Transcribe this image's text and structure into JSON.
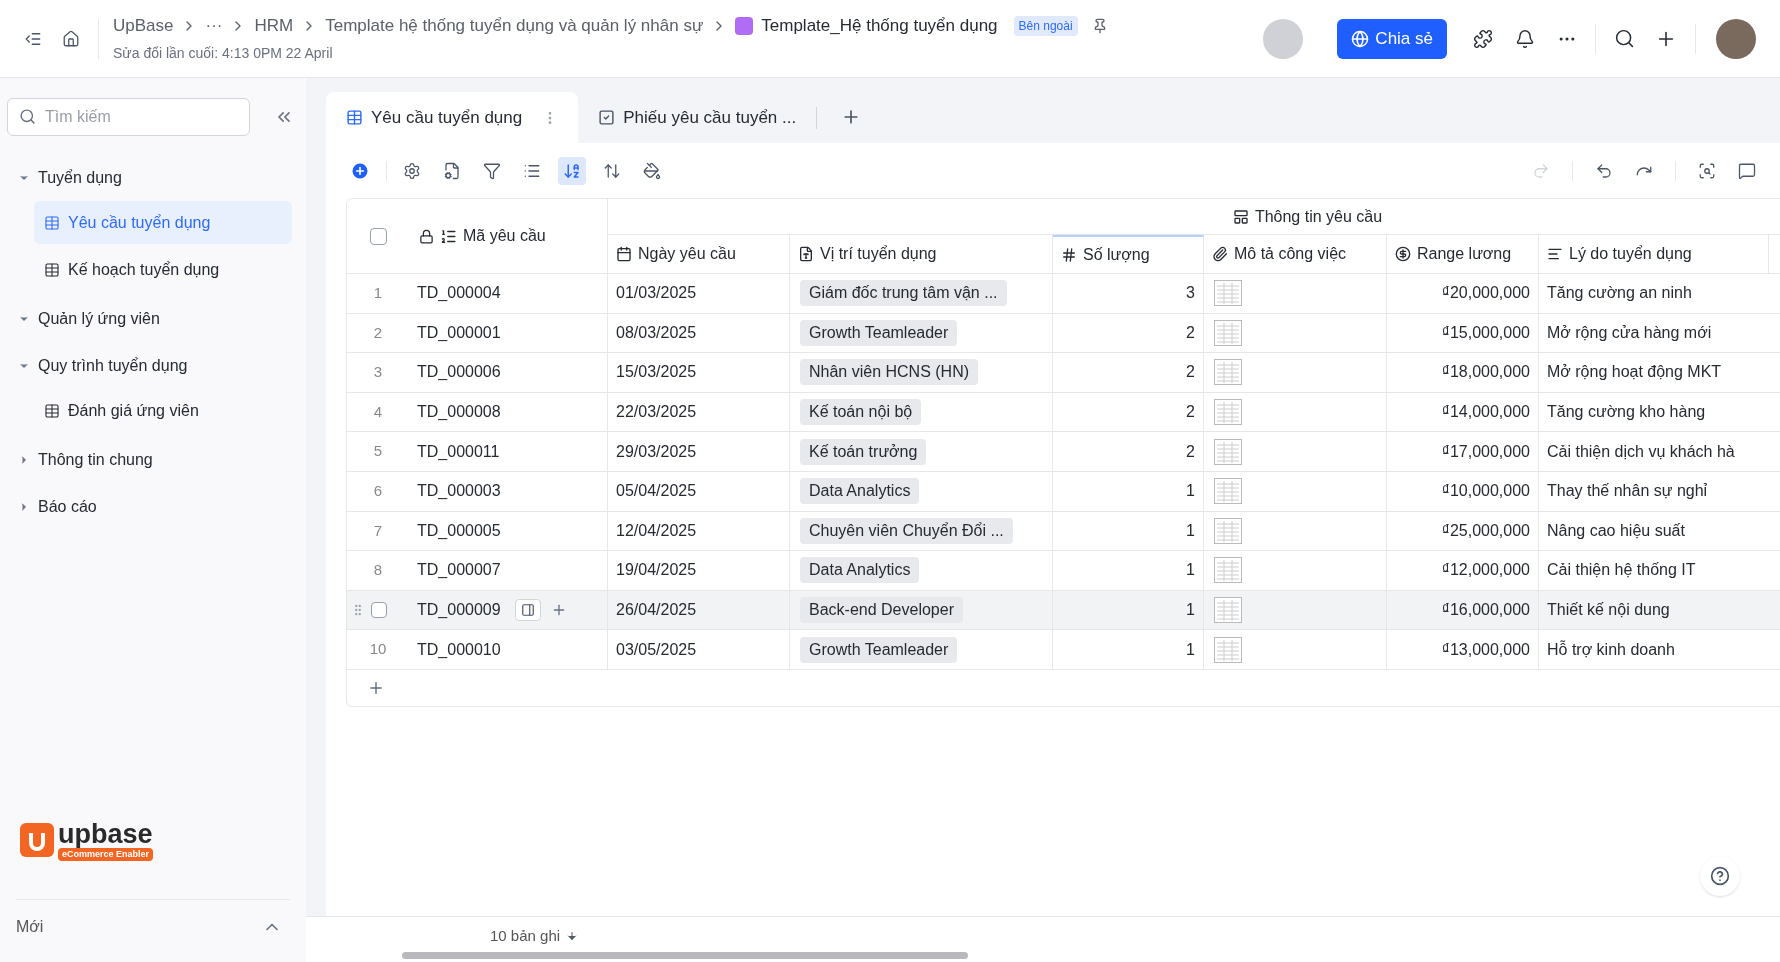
{
  "header": {
    "breadcrumbs": [
      "UpBase",
      "···",
      "HRM",
      "Template hệ thống tuyển dụng và quản lý nhân sự"
    ],
    "current": "Template_Hệ thống tuyển dụng",
    "badge": "Bên ngoài",
    "modified": "Sửa đổi lần cuối: 4:13 0PM 22 April",
    "share": "Chia sẻ"
  },
  "sidebar": {
    "search_placeholder": "Tìm kiếm",
    "items": [
      {
        "label": "Tuyển dụng",
        "kind": "folder",
        "expanded": true,
        "children": [
          {
            "label": "Yêu cầu tuyển dụng",
            "kind": "table",
            "selected": true
          },
          {
            "label": "Kế hoạch tuyển dụng",
            "kind": "table",
            "selected": false
          }
        ]
      },
      {
        "label": "Quản lý ứng viên",
        "kind": "folder",
        "expanded": true
      },
      {
        "label": "Quy trình tuyển dụng",
        "kind": "folder",
        "expanded": true,
        "children": [
          {
            "label": "Đánh giá ứng viên",
            "kind": "table",
            "selected": false
          }
        ]
      },
      {
        "label": "Thông tin chung",
        "kind": "folder",
        "expanded": false
      },
      {
        "label": "Báo cáo",
        "kind": "folder",
        "expanded": false
      }
    ],
    "logo": {
      "name": "upbase",
      "tagline": "eCommerce Enabler"
    },
    "footer": "Mới"
  },
  "tabs": [
    {
      "label": "Yêu cầu tuyển dụng",
      "selected": true
    },
    {
      "label": "Phiếu yêu cầu tuyển ...",
      "selected": false
    }
  ],
  "table": {
    "select_all_checked": false,
    "group_header": "Thông tin yêu cầu",
    "primary_column": "Mã yêu cầu",
    "columns": [
      "Ngày yêu cầu",
      "Vị trí tuyển dụng",
      "Số lượng",
      "Mô tả công việc",
      "Range lương",
      "Lý do tuyển dụng"
    ],
    "rows": [
      {
        "no": "1",
        "id": "TD_000004",
        "date": "01/03/2025",
        "position": "Giám đốc trung tâm vận ...",
        "qty": "3",
        "salary": "₫20,000,000",
        "reason": "Tăng cường an ninh",
        "hovered": false
      },
      {
        "no": "2",
        "id": "TD_000001",
        "date": "08/03/2025",
        "position": "Growth Teamleader",
        "qty": "2",
        "salary": "₫15,000,000",
        "reason": "Mở rộng cửa hàng mới",
        "hovered": false
      },
      {
        "no": "3",
        "id": "TD_000006",
        "date": "15/03/2025",
        "position": "Nhân viên HCNS (HN)",
        "qty": "2",
        "salary": "₫18,000,000",
        "reason": "Mở rộng hoạt động MKT",
        "hovered": false
      },
      {
        "no": "4",
        "id": "TD_000008",
        "date": "22/03/2025",
        "position": "Kế toán nội bộ",
        "qty": "2",
        "salary": "₫14,000,000",
        "reason": "Tăng cường kho hàng",
        "hovered": false
      },
      {
        "no": "5",
        "id": "TD_000011",
        "date": "29/03/2025",
        "position": "Kế toán trưởng",
        "qty": "2",
        "salary": "₫17,000,000",
        "reason": "Cải thiện dịch vụ khách hà",
        "hovered": false
      },
      {
        "no": "6",
        "id": "TD_000003",
        "date": "05/04/2025",
        "position": "Data Analytics",
        "qty": "1",
        "salary": "₫10,000,000",
        "reason": "Thay thế nhân sự nghỉ",
        "hovered": false
      },
      {
        "no": "7",
        "id": "TD_000005",
        "date": "12/04/2025",
        "position": "Chuyên viên Chuyển Đổi ...",
        "qty": "1",
        "salary": "₫25,000,000",
        "reason": "Nâng cao hiệu suất",
        "hovered": false
      },
      {
        "no": "8",
        "id": "TD_000007",
        "date": "19/04/2025",
        "position": "Data Analytics",
        "qty": "1",
        "salary": "₫12,000,000",
        "reason": "Cải thiện hệ thống IT",
        "hovered": false
      },
      {
        "id": "TD_000009",
        "date": "26/04/2025",
        "position": "Back-end Developer",
        "qty": "1",
        "salary": "₫16,000,000",
        "reason": "Thiết kế nội dung",
        "hovered": true,
        "checked": false
      },
      {
        "no": "10",
        "id": "TD_000010",
        "date": "03/05/2025",
        "position": "Growth Teamleader",
        "qty": "1",
        "salary": "₫13,000,000",
        "reason": "Hỗ trợ kinh doanh",
        "hovered": false
      }
    ]
  },
  "footer": {
    "records": "10 bản ghi"
  }
}
